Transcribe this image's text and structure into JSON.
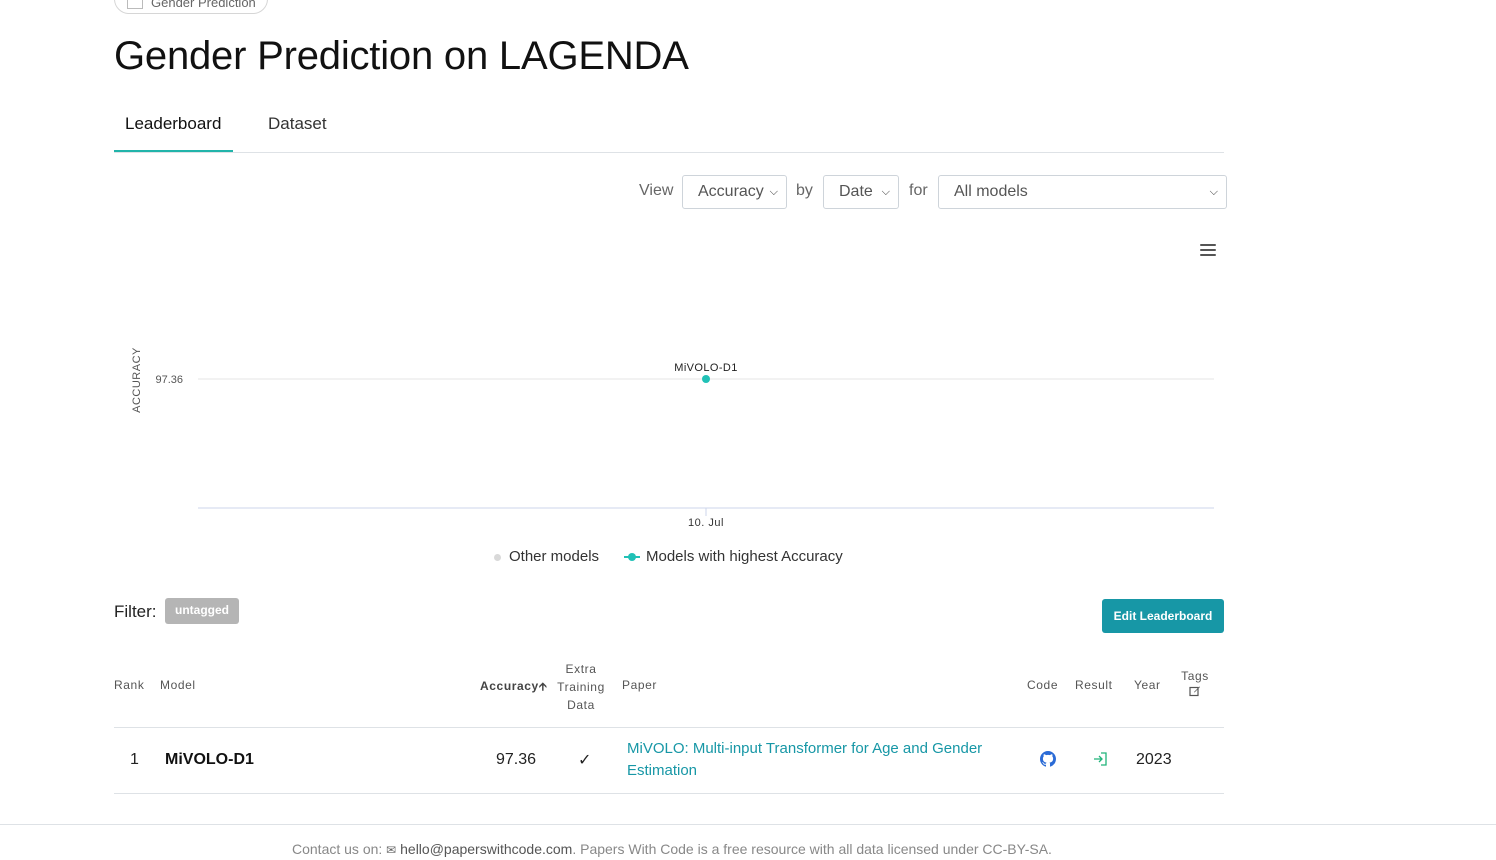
{
  "breadcrumb": {
    "chip_label": "Gender Prediction"
  },
  "page": {
    "title": "Gender Prediction on LAGENDA"
  },
  "tabs": [
    {
      "label": "Leaderboard"
    },
    {
      "label": "Dataset"
    }
  ],
  "controls": {
    "view_label": "View",
    "view_value": "Accuracy",
    "by_label": "by",
    "by_value": "Date",
    "for_label": "for",
    "for_value": "All models"
  },
  "chart_data": {
    "type": "scatter",
    "ylabel": "ACCURACY",
    "xlabel": "",
    "x_ticks": [
      "10. Jul"
    ],
    "y_ticks": [
      97.36
    ],
    "points": [
      {
        "x": "10. Jul",
        "y": 97.36,
        "label": "MiVOLO-D1",
        "series": "Models with highest Accuracy"
      }
    ],
    "legend": [
      {
        "name": "Other models",
        "color": "#d9d9d9"
      },
      {
        "name": "Models with highest Accuracy",
        "color": "#21c1b6"
      }
    ],
    "legend_position": "bottom-center",
    "grid": true
  },
  "filter": {
    "label": "Filter:",
    "tag": "untagged"
  },
  "edit_button": "Edit Leaderboard",
  "table": {
    "headers": {
      "rank": "Rank",
      "model": "Model",
      "accuracy": "Accuracy",
      "extra_training_data": [
        "Extra",
        "Training",
        "Data"
      ],
      "paper": "Paper",
      "code": "Code",
      "result": "Result",
      "year": "Year",
      "tags": "Tags"
    },
    "rows": [
      {
        "rank": "1",
        "model": "MiVOLO-D1",
        "accuracy": "97.36",
        "extra_training_data": "✓",
        "paper": "MiVOLO: Multi-input Transformer for Age and Gender Estimation",
        "year": "2023"
      }
    ]
  },
  "footer": {
    "contact_label": "Contact us on:",
    "email": "hello@paperswithcode.com",
    "text": ". Papers With Code is a free resource with all data licensed under CC-BY-SA."
  },
  "icons": {
    "code": "github-icon",
    "result": "result-link-icon",
    "tags_edit": "edit-icon",
    "mail": "mail-icon",
    "sort": "sort-arrow-icon"
  }
}
